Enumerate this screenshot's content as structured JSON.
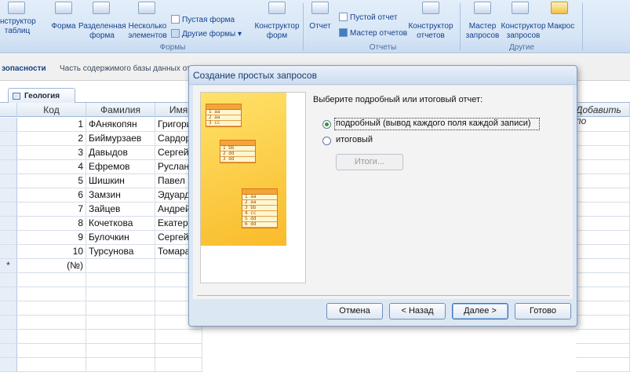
{
  "ribbon": {
    "forms": {
      "constructor_tables": "нструктор\nтаблиц",
      "form": "Форма",
      "split_form": "Разделенная\nформа",
      "multi_items": "Несколько\nэлементов",
      "blank_form": "Пустая форма",
      "other_forms": "Другие формы",
      "form_designer": "Конструктор\nформ",
      "group_title": "Формы"
    },
    "reports": {
      "report": "Отчет",
      "blank_report": "Пустой отчет",
      "report_wizard": "Мастер отчетов",
      "report_designer": "Конструктор\nотчетов",
      "group_title": "Отчеты"
    },
    "other": {
      "query_wizard": "Мастер\nзапросов",
      "query_designer": "Конструктор\nзапросов",
      "macro": "Макрос",
      "group_title": "Другие"
    }
  },
  "security_bar": {
    "title": "зопасности",
    "message": "Часть содержимого базы данных откл"
  },
  "table_tab": {
    "label": "Геология"
  },
  "grid": {
    "columns": [
      "Код",
      "Фамилия",
      "Имя"
    ],
    "add_field": "Добавить по",
    "rows": [
      {
        "id": "1",
        "last": "ФАнякопян",
        "first": "Григори"
      },
      {
        "id": "2",
        "last": "Биймурзаев",
        "first": "Сардор"
      },
      {
        "id": "3",
        "last": "Давыдов",
        "first": "Сергей"
      },
      {
        "id": "4",
        "last": "Ефремов",
        "first": "Руслан"
      },
      {
        "id": "5",
        "last": "Шишкин",
        "first": "Павел"
      },
      {
        "id": "6",
        "last": "Замзин",
        "first": "Эдуард"
      },
      {
        "id": "7",
        "last": "Зайцев",
        "first": "Андрей"
      },
      {
        "id": "8",
        "last": "Кочеткова",
        "first": "Екатери"
      },
      {
        "id": "9",
        "last": "Булочкин",
        "first": "Сергей"
      },
      {
        "id": "10",
        "last": "Турсунова",
        "first": "Томара"
      }
    ],
    "new_row_marker": "*",
    "new_row_id": "(№)"
  },
  "dialog": {
    "title": "Создание простых запросов",
    "prompt": "Выберите подробный или итоговый отчет:",
    "option_detail": "подробный (вывод каждого поля каждой записи)",
    "option_summary": "итоговый",
    "summary_button": "Итоги...",
    "cancel": "Отмена",
    "back": "< Назад",
    "next": "Далее >",
    "finish": "Готово",
    "preview_rows": {
      "t1": [
        "1  aa",
        "2  aa",
        "3  cc"
      ],
      "t2": [
        "1  bb",
        "2  dd",
        "3  dd"
      ],
      "t3": [
        "1  aa",
        "2  aa",
        "3  bb",
        "4  cc",
        "5  dd",
        "6  dd"
      ]
    }
  }
}
